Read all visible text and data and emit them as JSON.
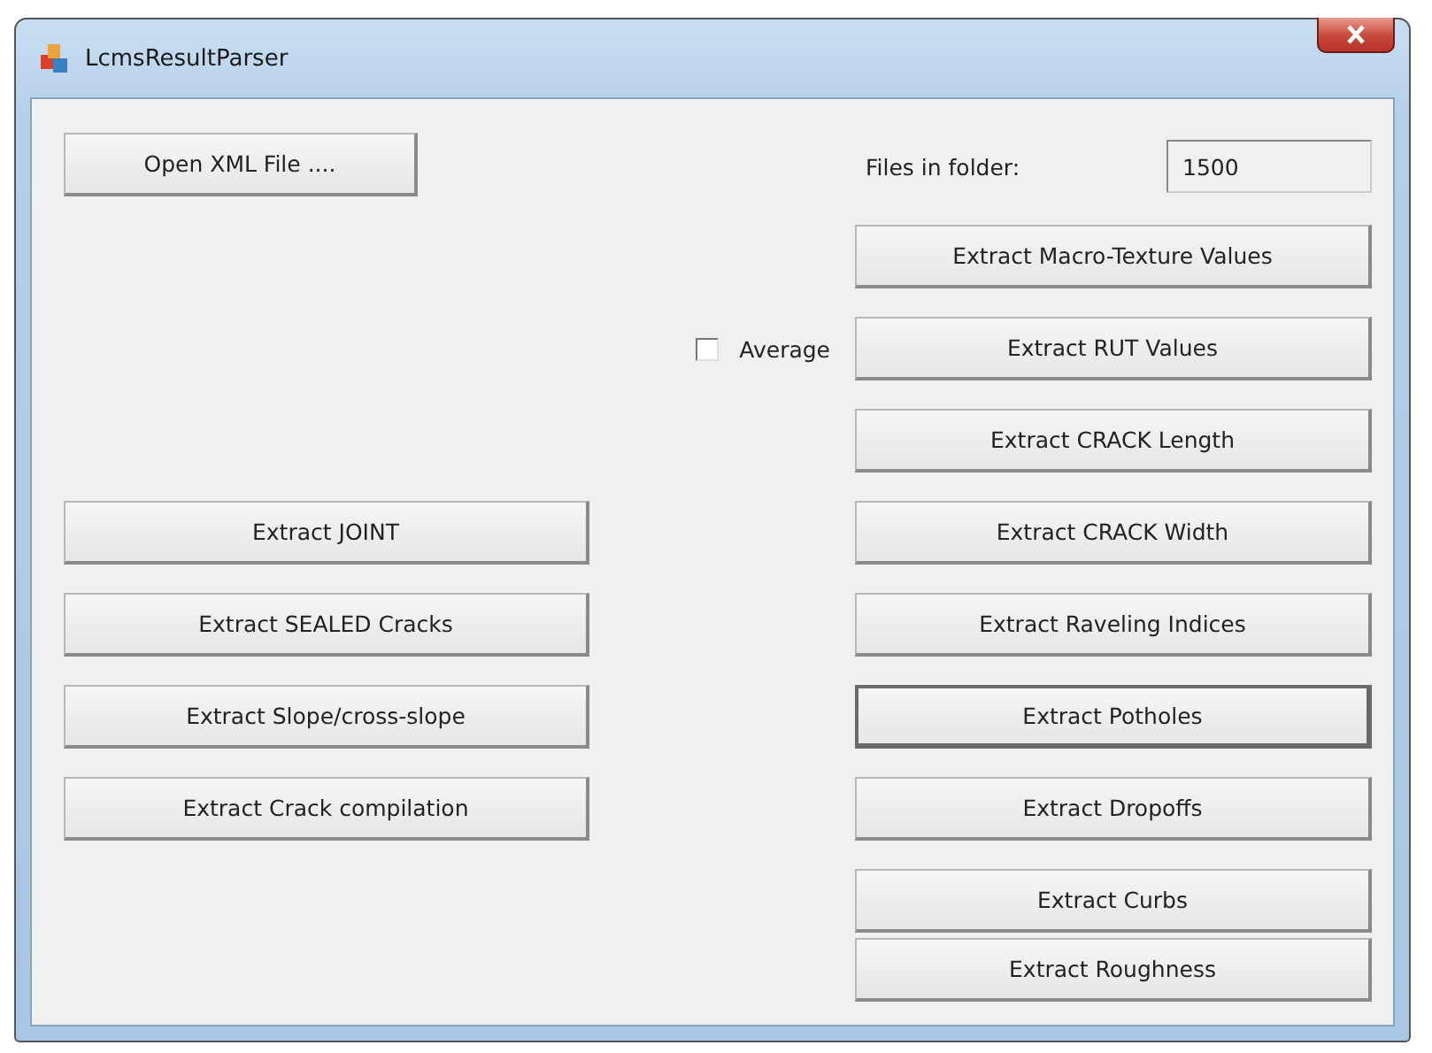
{
  "window": {
    "title": "LcmsResultParser"
  },
  "open_button": {
    "label": "Open XML File ...."
  },
  "files_in_folder": {
    "label": "Files in folder:",
    "value": "1500"
  },
  "average": {
    "label": "Average",
    "checked": false
  },
  "left_buttons": [
    {
      "label": "Extract JOINT",
      "focused": false
    },
    {
      "label": "Extract SEALED Cracks",
      "focused": false
    },
    {
      "label": "Extract Slope/cross-slope",
      "focused": false
    },
    {
      "label": "Extract Crack compilation",
      "focused": false
    }
  ],
  "right_buttons": [
    {
      "label": "Extract Macro-Texture Values",
      "focused": false
    },
    {
      "label": "Extract RUT Values",
      "focused": false
    },
    {
      "label": "Extract CRACK Length",
      "focused": false
    },
    {
      "label": "Extract CRACK Width",
      "focused": false
    },
    {
      "label": "Extract Raveling Indices",
      "focused": false
    },
    {
      "label": "Extract Potholes",
      "focused": true
    },
    {
      "label": "Extract Dropoffs",
      "focused": false
    },
    {
      "label": "Extract Curbs",
      "focused": false
    },
    {
      "label": "Extract Roughness",
      "focused": false
    }
  ]
}
